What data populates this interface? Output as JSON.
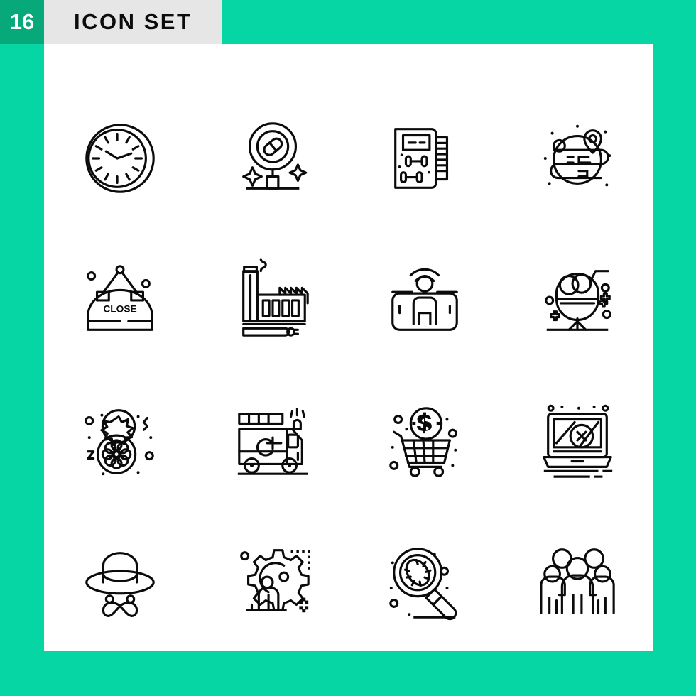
{
  "header": {
    "count": "16",
    "title": "ICON SET",
    "badge_color": "#07A97B",
    "title_bg_color": "#E6E6E6",
    "title_color": "#0C0C0C"
  },
  "page": {
    "background_color": "#06D6A4",
    "panel_color": "#FFFFFF",
    "stroke_color": "#0B0B0B"
  },
  "grid": {
    "rows": 4,
    "columns": 4,
    "total": 16
  },
  "icons": [
    {
      "index": 1,
      "name": "wall-clock-icon",
      "label": "Wall Clock"
    },
    {
      "index": 2,
      "name": "medicine-search-icon",
      "label": "Medicine Search"
    },
    {
      "index": 3,
      "name": "workout-notebook-icon",
      "label": "Workout Notebook"
    },
    {
      "index": 4,
      "name": "globe-location-icon",
      "label": "Global Location"
    },
    {
      "index": 5,
      "name": "close-sign-icon",
      "label": "Close Sign",
      "sign_text": "CLOSE"
    },
    {
      "index": 6,
      "name": "factory-icon",
      "label": "Factory"
    },
    {
      "index": 7,
      "name": "mobile-user-signal-icon",
      "label": "Mobile User Signal"
    },
    {
      "index": 8,
      "name": "ice-cream-sundae-icon",
      "label": "Ice Cream Sundae"
    },
    {
      "index": 9,
      "name": "sun-snowflake-weather-icon",
      "label": "Weather Sun Snowflake"
    },
    {
      "index": 10,
      "name": "fire-truck-icon",
      "label": "Fire Truck"
    },
    {
      "index": 11,
      "name": "shopping-cart-dollar-icon",
      "label": "Shopping Cart Dollar"
    },
    {
      "index": 12,
      "name": "laptop-error-icon",
      "label": "Laptop Error"
    },
    {
      "index": 13,
      "name": "hat-mustache-icon",
      "label": "Hat and Mustache"
    },
    {
      "index": 14,
      "name": "gear-user-settings-icon",
      "label": "User Settings Gear"
    },
    {
      "index": 15,
      "name": "bacteria-search-icon",
      "label": "Bacteria Search"
    },
    {
      "index": 16,
      "name": "group-people-icon",
      "label": "Group of People"
    }
  ]
}
